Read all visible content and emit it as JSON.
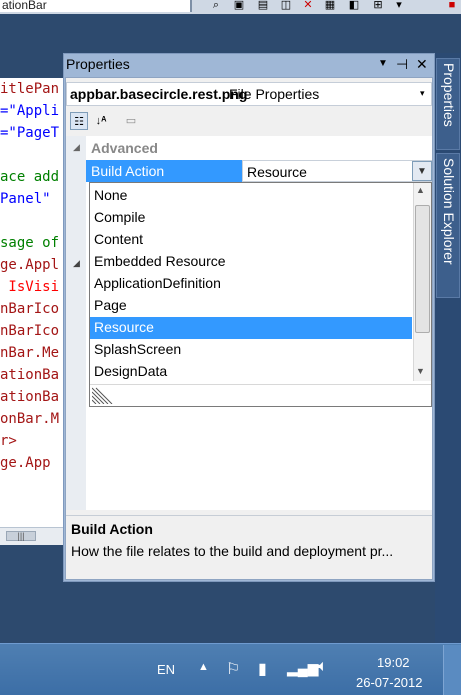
{
  "top": {
    "partial_title": "ationBar"
  },
  "code_lines": [
    {
      "text": "itlePan",
      "color": "#a31515"
    },
    {
      "text": "=\"Appli",
      "color": "#0000ff"
    },
    {
      "text": "=\"PageT",
      "color": "#0000ff"
    },
    {
      "text": "",
      "color": "#000000"
    },
    {
      "text": "ace add",
      "color": "#008000"
    },
    {
      "text": "Panel\" ",
      "color": "#0000ff"
    },
    {
      "text": "",
      "color": "#000000"
    },
    {
      "text": "sage of",
      "color": "#008000"
    },
    {
      "text": "ge.Appl",
      "color": "#a31515"
    },
    {
      "text": " IsVisi",
      "color": "#ff0000"
    },
    {
      "text": "nBarIco",
      "color": "#a31515"
    },
    {
      "text": "nBarIco",
      "color": "#a31515"
    },
    {
      "text": "nBar.Me",
      "color": "#a31515"
    },
    {
      "text": "ationBa",
      "color": "#a31515"
    },
    {
      "text": "ationBa",
      "color": "#a31515"
    },
    {
      "text": "onBar.M",
      "color": "#a31515"
    },
    {
      "text": "r>",
      "color": "#a31515"
    },
    {
      "text": "ge.App",
      "color": "#a31515"
    }
  ],
  "properties": {
    "title": "Properties",
    "object_name": "appbar.basecircle.rest.png",
    "object_type": "File Properties",
    "category": "Advanced",
    "property_name": "Build Action",
    "property_value": "Resource",
    "options": [
      "None",
      "Compile",
      "Content",
      "Embedded Resource",
      "ApplicationDefinition",
      "Page",
      "Resource",
      "SplashScreen",
      "DesignData"
    ],
    "selected_option": "Resource",
    "description_title": "Build Action",
    "description_text": "How the file relates to the build and deployment pr..."
  },
  "side_tabs": {
    "properties": "Properties",
    "solution_explorer": "Solution Explorer"
  },
  "taskbar": {
    "language": "EN",
    "time": "19:02",
    "date": "26-07-2012"
  },
  "colors": {
    "selection": "#3399ff",
    "taskbar": "#3c6ea6",
    "window_frame": "#9fb7d6"
  }
}
